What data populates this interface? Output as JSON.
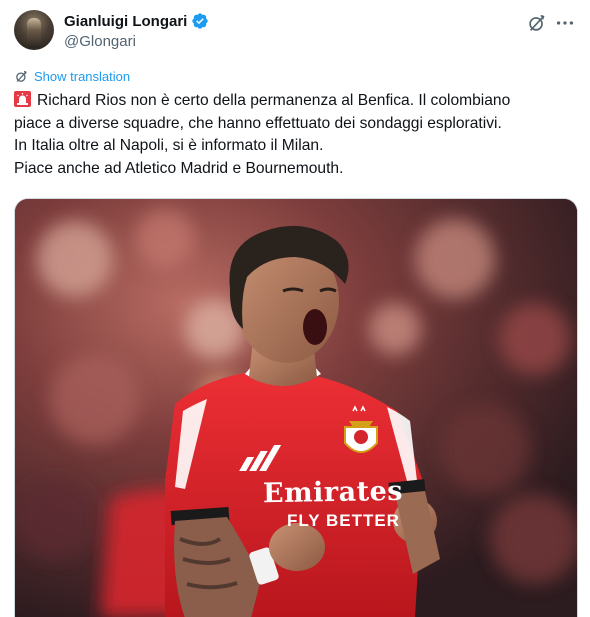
{
  "author": {
    "display_name": "Gianluigi Longari",
    "handle": "@Glongari",
    "verified": true
  },
  "actions": {
    "grok_icon": "grok-icon",
    "more_icon": "more-icon"
  },
  "translation": {
    "label": "Show translation",
    "icon": "translate-icon"
  },
  "tweet": {
    "emoji_icon": "siren-emoji",
    "lines": [
      "Richard Rios non è certo della permanenza al Benfica. Il colombiano",
      "piace a diverse squadre, che hanno effettuato dei sondaggi esplorativi.",
      "In Italia oltre al Napoli, si è informato il Milan.",
      "Piace anche ad Atletico Madrid e Bournemouth."
    ]
  },
  "media": {
    "shirt_sponsor_line1": "Emirates",
    "shirt_sponsor_line2": "FLY BETTER"
  },
  "colors": {
    "accent": "#1d9bf0",
    "text": "#0f1419",
    "secondary": "#536471",
    "shirt_red": "#e0242c"
  }
}
